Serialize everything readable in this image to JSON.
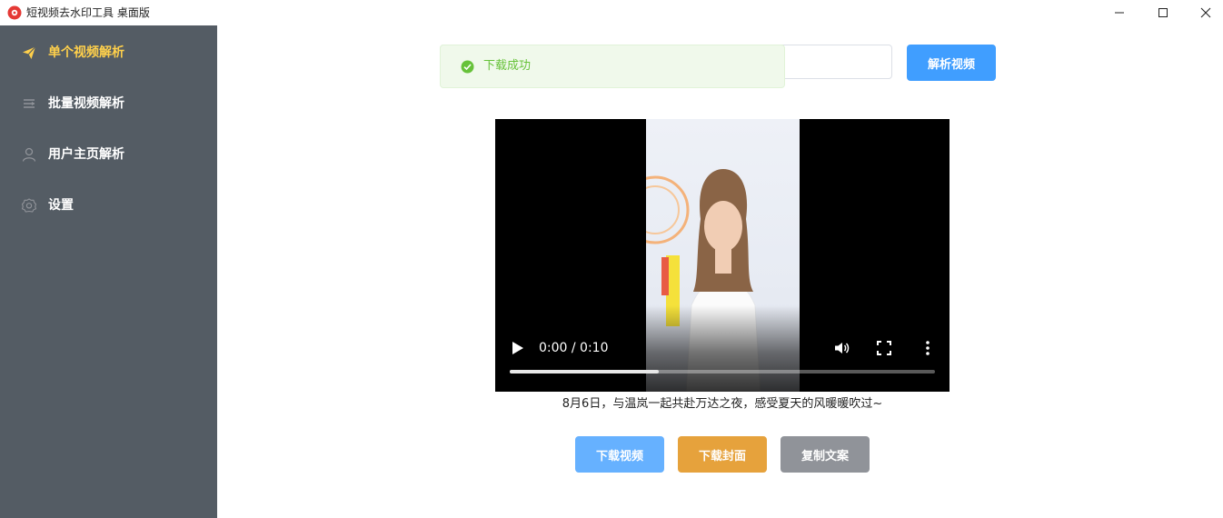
{
  "window": {
    "title": "短视频去水印工具 桌面版",
    "icon": "app-logo-icon",
    "controls": [
      "minimize-icon",
      "maximize-icon",
      "close-icon"
    ]
  },
  "sidebar": {
    "background": "#545c64",
    "active_color": "#ffd04b",
    "items": [
      {
        "label": "单个视频解析",
        "icon": "paper-plane-icon",
        "active": true
      },
      {
        "label": "批量视频解析",
        "icon": "list-icon",
        "active": false
      },
      {
        "label": "用户主页解析",
        "icon": "user-icon",
        "active": false
      },
      {
        "label": "设置",
        "icon": "gear-icon",
        "active": false
      }
    ]
  },
  "main": {
    "url_input": {
      "value": "",
      "placeholder": ""
    },
    "parse_button": "解析视频",
    "toast": {
      "text": "下载成功",
      "type": "success",
      "color": "#67c23a"
    },
    "video": {
      "time": "0:00 / 0:10",
      "progress": 0.35,
      "controls": [
        "play-icon",
        "volume-icon",
        "fullscreen-icon",
        "more-vertical-icon"
      ]
    },
    "caption": "8月6日，与温岚一起共赴万达之夜，感受夏天的风暖暖吹过~",
    "actions": [
      {
        "label": "下载视频",
        "color": "#66b1ff"
      },
      {
        "label": "下载封面",
        "color": "#e6a23c"
      },
      {
        "label": "复制文案",
        "color": "#909399"
      }
    ]
  }
}
